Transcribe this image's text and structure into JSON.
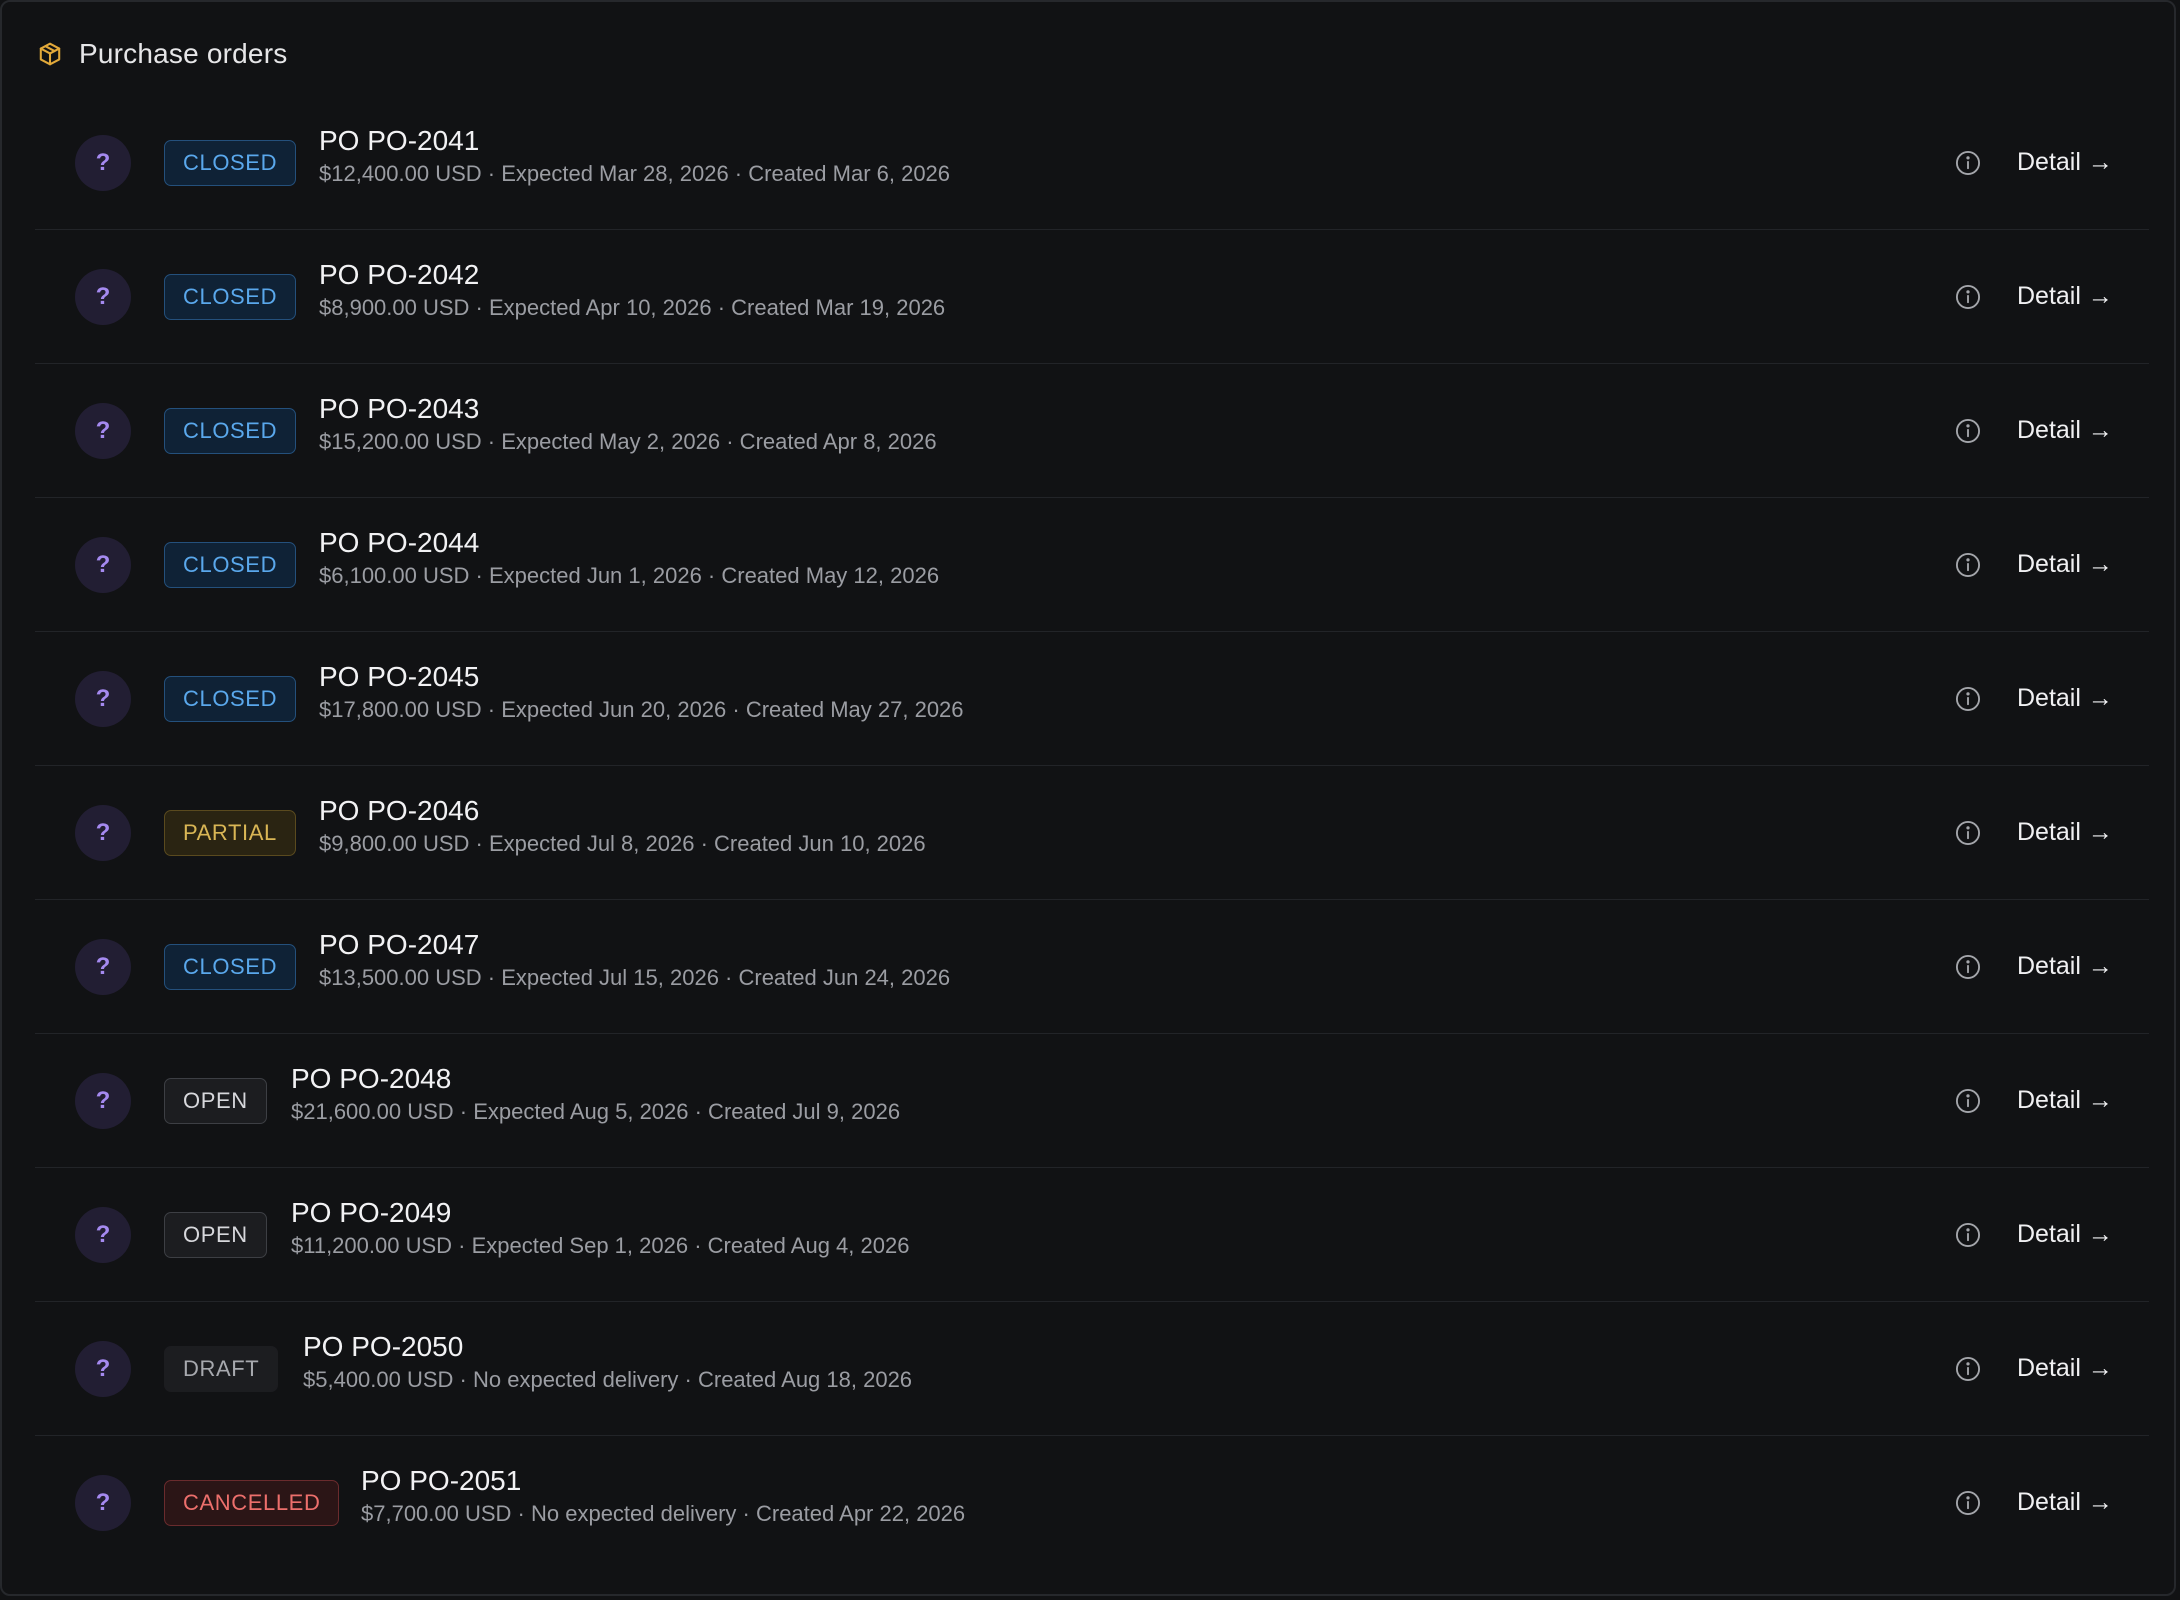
{
  "header": {
    "title": "Purchase orders",
    "icon": "package-icon",
    "icon_color": "#e2a93a"
  },
  "colors": {
    "background": "#111214",
    "avatar_bg": "#221e33",
    "avatar_fg": "#a58af0",
    "closed": "#5aa8ec",
    "partial": "#d9b655",
    "open": "#d7d8dc",
    "draft": "#a7a9ae",
    "cancelled": "#ec6f6c"
  },
  "orders": [
    {
      "avatar": "?",
      "status": "CLOSED",
      "status_key": "closed",
      "title": "PO PO-2041",
      "meta": "$12,400.00 USD · Expected Mar 28, 2026 · Created Mar 6, 2026",
      "action": "Detail →"
    },
    {
      "avatar": "?",
      "status": "CLOSED",
      "status_key": "closed",
      "title": "PO PO-2042",
      "meta": "$8,900.00 USD · Expected Apr 10, 2026 · Created Mar 19, 2026",
      "action": "Detail →"
    },
    {
      "avatar": "?",
      "status": "CLOSED",
      "status_key": "closed",
      "title": "PO PO-2043",
      "meta": "$15,200.00 USD · Expected May 2, 2026 · Created Apr 8, 2026",
      "action": "Detail →"
    },
    {
      "avatar": "?",
      "status": "CLOSED",
      "status_key": "closed",
      "title": "PO PO-2044",
      "meta": "$6,100.00 USD · Expected Jun 1, 2026 · Created May 12, 2026",
      "action": "Detail →"
    },
    {
      "avatar": "?",
      "status": "CLOSED",
      "status_key": "closed",
      "title": "PO PO-2045",
      "meta": "$17,800.00 USD · Expected Jun 20, 2026 · Created May 27, 2026",
      "action": "Detail →"
    },
    {
      "avatar": "?",
      "status": "PARTIAL",
      "status_key": "partial",
      "title": "PO PO-2046",
      "meta": "$9,800.00 USD · Expected Jul 8, 2026 · Created Jun 10, 2026",
      "action": "Detail →"
    },
    {
      "avatar": "?",
      "status": "CLOSED",
      "status_key": "closed",
      "title": "PO PO-2047",
      "meta": "$13,500.00 USD · Expected Jul 15, 2026 · Created Jun 24, 2026",
      "action": "Detail →"
    },
    {
      "avatar": "?",
      "status": "OPEN",
      "status_key": "open",
      "title": "PO PO-2048",
      "meta": "$21,600.00 USD · Expected Aug 5, 2026 · Created Jul 9, 2026",
      "action": "Detail →"
    },
    {
      "avatar": "?",
      "status": "OPEN",
      "status_key": "open",
      "title": "PO PO-2049",
      "meta": "$11,200.00 USD · Expected Sep 1, 2026 · Created Aug 4, 2026",
      "action": "Detail →"
    },
    {
      "avatar": "?",
      "status": "DRAFT",
      "status_key": "draft",
      "title": "PO PO-2050",
      "meta": "$5,400.00 USD · No expected delivery · Created Aug 18, 2026",
      "action": "Detail →"
    },
    {
      "avatar": "?",
      "status": "CANCELLED",
      "status_key": "cancelled",
      "title": "PO PO-2051",
      "meta": "$7,700.00 USD · No expected delivery · Created Apr 22, 2026",
      "action": "Detail →"
    }
  ]
}
